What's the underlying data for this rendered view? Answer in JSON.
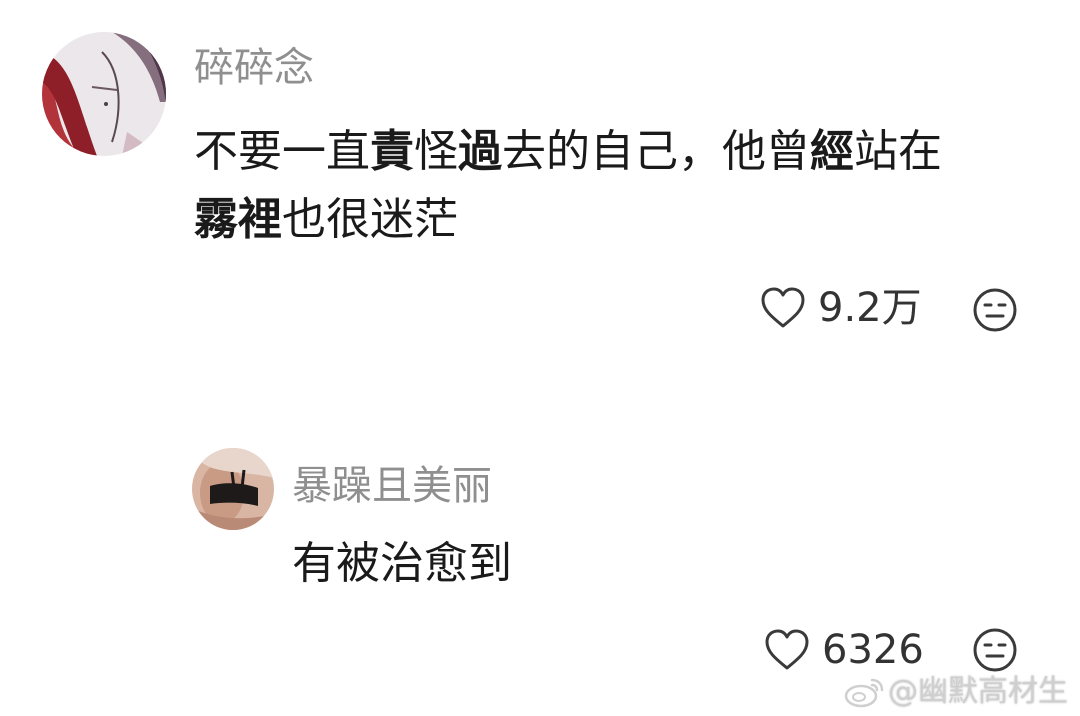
{
  "comment": {
    "username": "碎碎念",
    "line1": {
      "p1": "不要一直",
      "b1": "責",
      "p2": "怪",
      "b2": "過",
      "p3": "去的自己，他曾",
      "b3": "經",
      "p4": "站在"
    },
    "line2": {
      "b1": "霧裡",
      "p1": "也很迷茫"
    },
    "likes": "9.2万",
    "like_icon": "heart-icon",
    "reaction_icon": "neutral-face-icon"
  },
  "reply": {
    "username": "暴躁且美丽",
    "text": "有被治愈到",
    "likes": "6326",
    "like_icon": "heart-icon",
    "reaction_icon": "neutral-face-icon"
  },
  "watermark": {
    "text": "@幽默高材生",
    "icon": "weibo-logo-icon"
  }
}
